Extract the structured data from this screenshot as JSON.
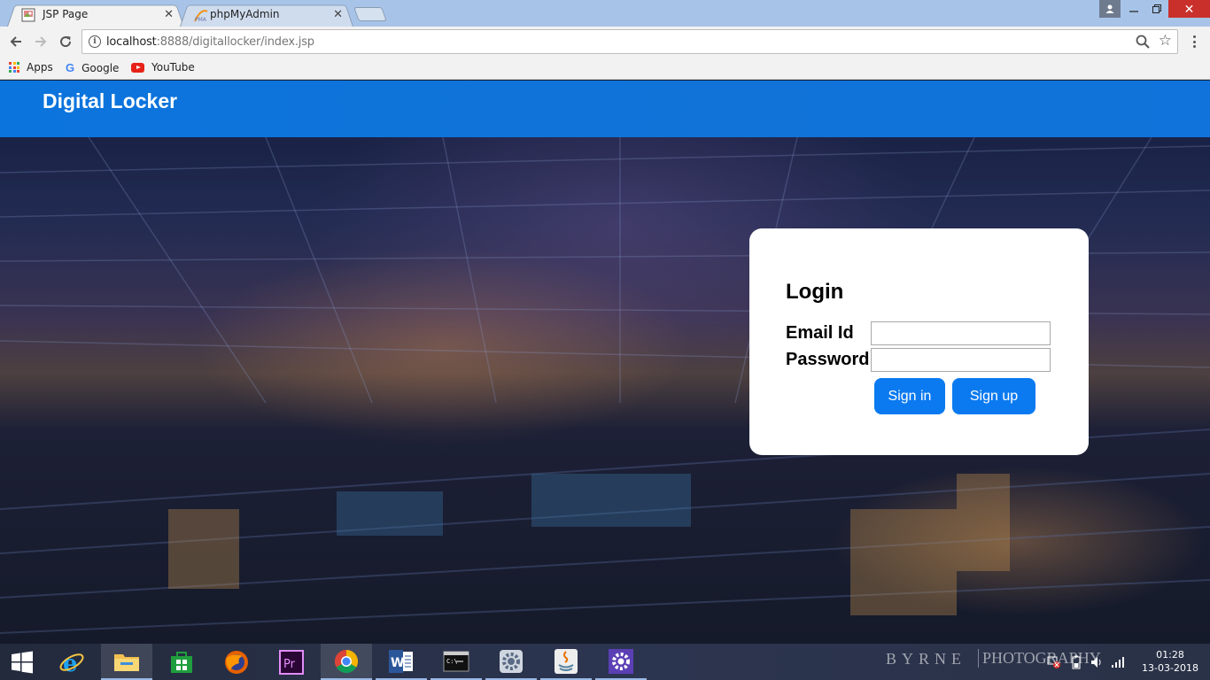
{
  "browser": {
    "tabs": [
      {
        "title": "JSP Page",
        "active": true
      },
      {
        "title": "phpMyAdmin",
        "active": false
      }
    ],
    "url_host": "localhost",
    "url_rest": ":8888/digitallocker/index.jsp",
    "bookmarks": [
      {
        "label": "Apps",
        "icon": "apps-grid-icon"
      },
      {
        "label": "Google",
        "icon": "google-icon"
      },
      {
        "label": "YouTube",
        "icon": "youtube-icon"
      }
    ]
  },
  "page": {
    "site_title": "Digital Locker",
    "login": {
      "title": "Login",
      "email_label": "Email Id",
      "password_label": "Password",
      "email_value": "",
      "password_value": "",
      "signin_label": "Sign in",
      "signup_label": "Sign up"
    }
  },
  "taskbar": {
    "apps": [
      "start",
      "internet-explorer",
      "file-explorer",
      "store",
      "firefox",
      "premiere-pro",
      "chrome",
      "word",
      "command-prompt",
      "settings-gear",
      "java",
      "control-panel"
    ],
    "watermark_left": "BYRNE",
    "watermark_right": "PHOTOGRAPHY",
    "time": "01:28",
    "date": "13-03-2018"
  },
  "colors": {
    "header_blue": "#0b74dd",
    "button_blue": "#0b7af0",
    "tabstrip": "#a7c4e8"
  }
}
